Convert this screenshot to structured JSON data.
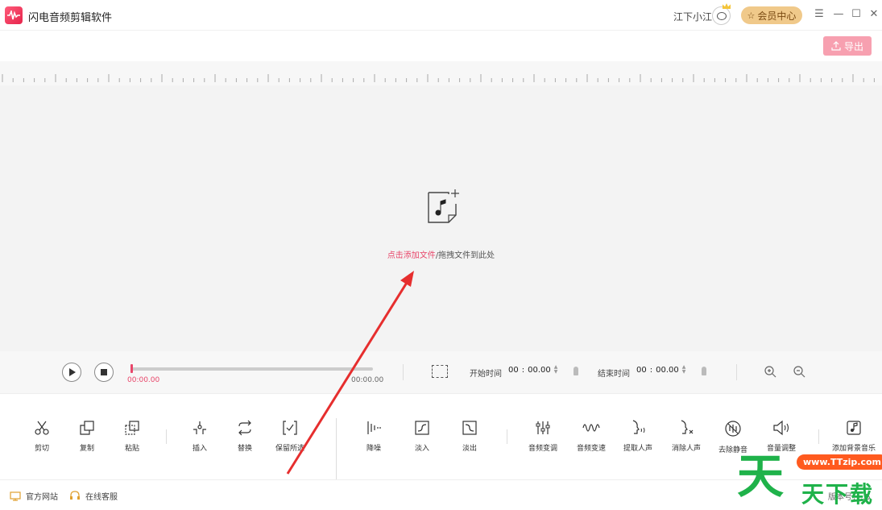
{
  "app": {
    "title": "闪电音频剪辑软件",
    "accent": "#e8466a"
  },
  "header": {
    "user_name": "江下小江",
    "vip_label": "会员中心",
    "menu_icon": "menu-icon",
    "minimize_icon": "minimize-icon",
    "maximize_icon": "maximize-icon",
    "close_icon": "close-icon"
  },
  "export": {
    "label": "导出"
  },
  "canvas": {
    "add_link": "点击添加文件",
    "drag_hint": "/拖拽文件到此处"
  },
  "player": {
    "current_time": "00:00.00",
    "total_time": "00:00.00",
    "start_label": "开始时间",
    "start_min": "00",
    "start_sec": "00.00",
    "end_label": "结束时间",
    "end_min": "00",
    "end_sec": "00.00",
    "sep": ":"
  },
  "toolbar": {
    "tools": [
      {
        "label": "剪切",
        "icon": "scissors-icon"
      },
      {
        "label": "复制",
        "icon": "copy-icon"
      },
      {
        "label": "粘贴",
        "icon": "paste-icon"
      },
      {
        "label": "插入",
        "icon": "insert-icon"
      },
      {
        "label": "替换",
        "icon": "replace-icon"
      },
      {
        "label": "保留所选",
        "icon": "keep-selection-icon"
      },
      {
        "label": "降噪",
        "icon": "denoise-icon"
      },
      {
        "label": "淡入",
        "icon": "fade-in-icon"
      },
      {
        "label": "淡出",
        "icon": "fade-out-icon"
      },
      {
        "label": "音频变调",
        "icon": "pitch-icon"
      },
      {
        "label": "音频变速",
        "icon": "speed-icon"
      },
      {
        "label": "提取人声",
        "icon": "extract-voice-icon"
      },
      {
        "label": "消除人声",
        "icon": "remove-voice-icon"
      },
      {
        "label": "去除静音",
        "icon": "remove-silence-icon"
      },
      {
        "label": "音量调整",
        "icon": "volume-icon"
      },
      {
        "label": "添加背景音乐",
        "icon": "bgm-icon"
      }
    ]
  },
  "status": {
    "website": "官方网站",
    "support": "在线客服",
    "version": "版本号：..5"
  },
  "watermark": {
    "big": "天",
    "pill": "www.TTzip.com",
    "small": "天下载"
  }
}
